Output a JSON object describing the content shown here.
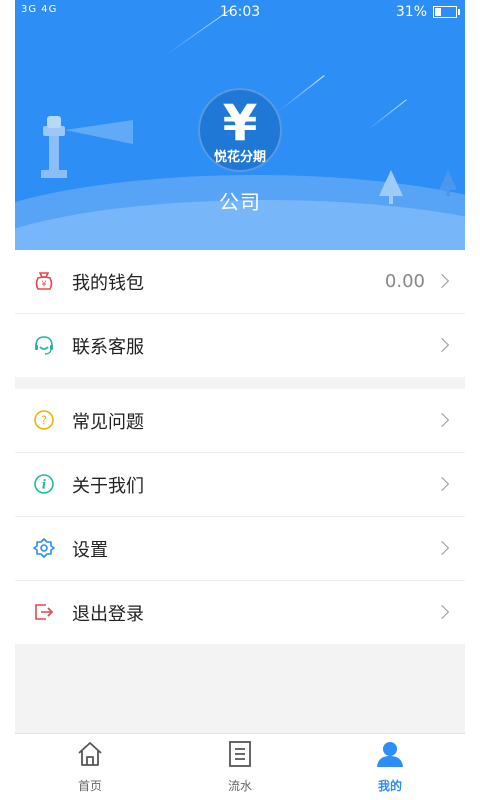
{
  "status_bar": {
    "signal": "3G 4G",
    "time": "16:03",
    "battery_percent": "31%",
    "battery_level": 0.31
  },
  "profile": {
    "logo_symbol": "¥",
    "logo_text": "悦花分期",
    "company": "公司"
  },
  "menu_group_1": [
    {
      "label": "我的钱包",
      "value": "0.00",
      "icon": "wallet-icon",
      "icon_color": "#e5484d"
    },
    {
      "label": "联系客服",
      "icon": "customer-service-icon",
      "icon_color": "#27b6a1"
    }
  ],
  "menu_group_2": [
    {
      "label": "常见问题",
      "icon": "question-icon",
      "icon_color": "#f0b400"
    },
    {
      "label": "关于我们",
      "icon": "info-icon",
      "icon_color": "#27b6a1"
    },
    {
      "label": "设置",
      "icon": "gear-icon",
      "icon_color": "#2d8ef5"
    },
    {
      "label": "退出登录",
      "icon": "logout-icon",
      "icon_color": "#e5484d"
    }
  ],
  "tabbar": [
    {
      "label": "首页",
      "icon": "home-icon",
      "active": false
    },
    {
      "label": "流水",
      "icon": "list-icon",
      "active": false
    },
    {
      "label": "我的",
      "icon": "user-icon",
      "active": true
    }
  ],
  "colors": {
    "accent": "#2d8ef5",
    "background": "#f3f3f3"
  }
}
